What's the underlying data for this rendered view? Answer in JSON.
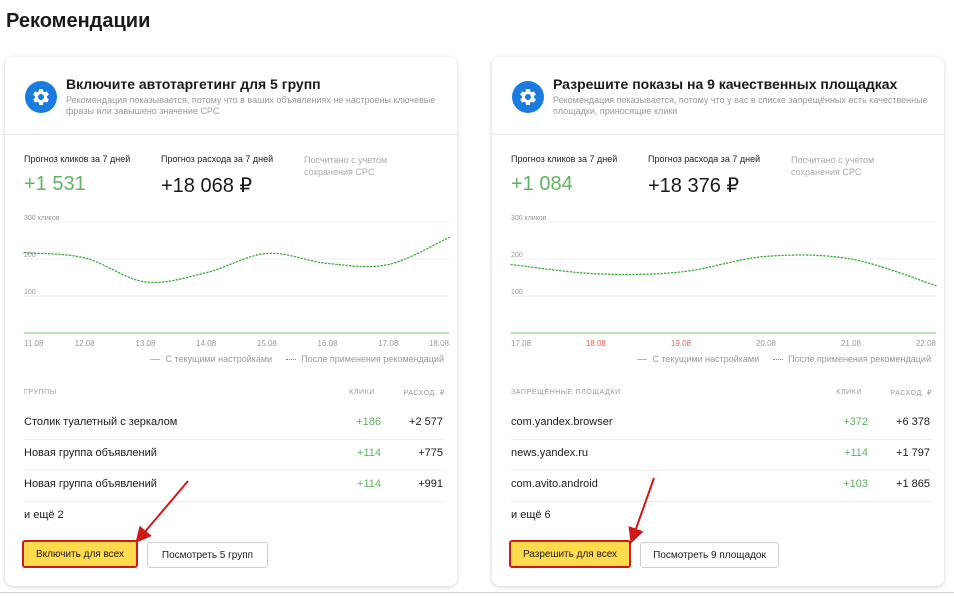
{
  "page": {
    "title": "Рекомендации"
  },
  "cards": [
    {
      "title": "Включите автотаргетинг для 5 групп",
      "description": "Рекомендация показывается, потому что в ваших объявлениях не настроены ключевые фразы или завышено значение CPC",
      "clicks_forecast_label": "Прогноз кликов за 7 дней",
      "clicks_forecast_value": "+1 531",
      "spend_forecast_label": "Прогноз расхода за 7 дней",
      "spend_forecast_value": "+18 068 ₽",
      "forecast_note": "Посчитано с учетом\nсохранения CPC",
      "table": {
        "col_name": "ГРУППЫ",
        "col_clicks": "КЛИКИ",
        "col_spend": "РАСХОД, ₽",
        "rows": [
          {
            "name": "Столик туалетный с зеркалом",
            "clicks": "+186",
            "spend": "+2 577"
          },
          {
            "name": "Новая группа объявлений",
            "clicks": "+114",
            "spend": "+775"
          },
          {
            "name": "Новая группа объявлений",
            "clicks": "+114",
            "spend": "+991"
          }
        ]
      },
      "more": "и ещё 2",
      "primary_button": "Включить для всех",
      "secondary_button": "Посмотреть 5 групп"
    },
    {
      "title": "Разрешите показы на 9 качественных площадках",
      "description": "Рекомендация показывается, потому что у вас в списке запрещённых есть качественные площадки, приносящие клики",
      "clicks_forecast_label": "Прогноз кликов за 7 дней",
      "clicks_forecast_value": "+1 084",
      "spend_forecast_label": "Прогноз расхода за 7 дней",
      "spend_forecast_value": "+18 376 ₽",
      "forecast_note": "Посчитано с учетом\nсохранения CPC",
      "table": {
        "col_name": "ЗАПРЕЩЁННЫЕ ПЛОЩАДКИ",
        "col_clicks": "КЛИКИ",
        "col_spend": "РАСХОД, ₽",
        "rows": [
          {
            "name": "com.yandex.browser",
            "clicks": "+372",
            "spend": "+6 378"
          },
          {
            "name": "news.yandex.ru",
            "clicks": "+114",
            "spend": "+1 797"
          },
          {
            "name": "com.avito.android",
            "clicks": "+103",
            "spend": "+1 865"
          }
        ]
      },
      "more": "и ещё 6",
      "primary_button": "Разрешить для всех",
      "secondary_button": "Посмотреть 9 площадок"
    }
  ],
  "chart_data": [
    {
      "type": "line",
      "ylabel": "",
      "ytick_labels": [
        "300 кликов",
        "200",
        "100"
      ],
      "yticks": [
        300,
        200,
        100
      ],
      "ylim": [
        0,
        300
      ],
      "x": [
        "11.08",
        "12.08",
        "13.08",
        "14.08",
        "15.08",
        "16.08",
        "17.08",
        "18.08"
      ],
      "weekend_x": [],
      "grid": true,
      "legend_position": "bottom-right",
      "series": [
        {
          "name": "С текущими настройками",
          "style": "solid",
          "color": "#8fd28f",
          "values": [
            0,
            0,
            0,
            0,
            0,
            0,
            0,
            0
          ]
        },
        {
          "name": "После применения рекомендаций",
          "style": "dotted",
          "color": "#3ea83e",
          "values": [
            217,
            203,
            138,
            163,
            215,
            188,
            185,
            258
          ]
        }
      ]
    },
    {
      "type": "line",
      "ylabel": "",
      "ytick_labels": [
        "300 кликов",
        "200",
        "100"
      ],
      "yticks": [
        300,
        200,
        100
      ],
      "ylim": [
        0,
        300
      ],
      "x": [
        "17.08",
        "18.08",
        "19.08",
        "20.08",
        "21.08",
        "22.08"
      ],
      "weekend_x": [
        "18.08",
        "19.08"
      ],
      "grid": true,
      "legend_position": "bottom-right",
      "series": [
        {
          "name": "С текущими настройками",
          "style": "solid",
          "color": "#8fd28f",
          "values": [
            0,
            0,
            0,
            0,
            0,
            0
          ]
        },
        {
          "name": "После применения рекомендаций",
          "style": "dotted",
          "color": "#3ea83e",
          "values": [
            185,
            160,
            165,
            207,
            200,
            128
          ]
        }
      ]
    }
  ],
  "colors": {
    "accent": "#1a7ce0",
    "positive": "#5fb461",
    "button_primary": "#ffdb4d",
    "highlight_border": "#d01818",
    "weekend_tick": "#e86060"
  },
  "icons": {
    "card_icon": "gear-icon"
  }
}
